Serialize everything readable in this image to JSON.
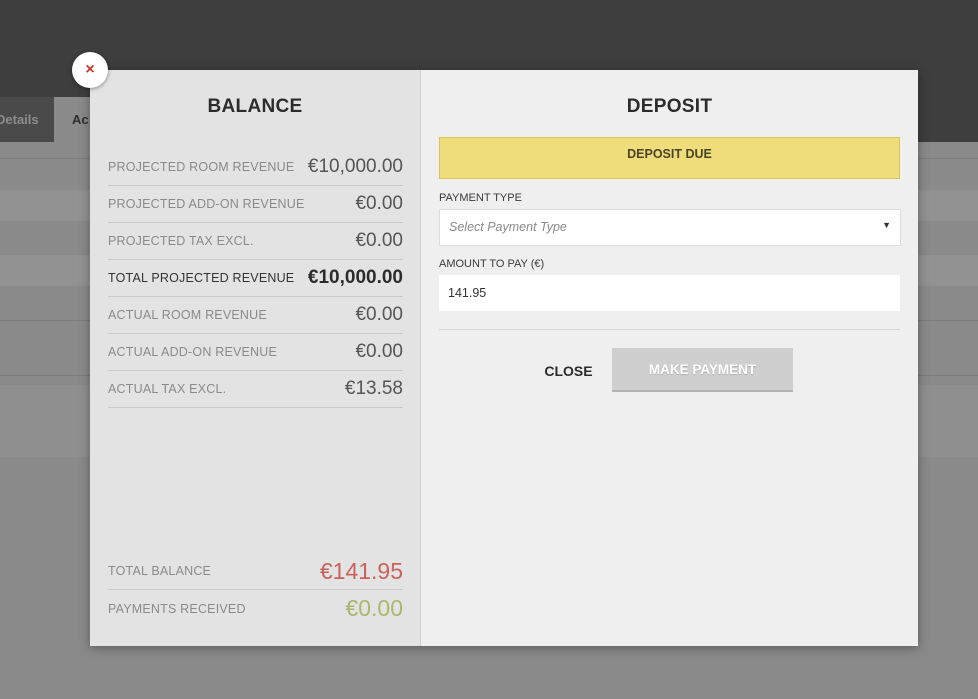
{
  "background": {
    "tab1_label": "Details",
    "tab2_label": "Ac"
  },
  "modal": {
    "close_icon": "×",
    "balance": {
      "title": "BALANCE",
      "rows": [
        {
          "label": "PROJECTED ROOM REVENUE",
          "value": "€10,000.00"
        },
        {
          "label": "PROJECTED ADD-ON REVENUE",
          "value": "€0.00"
        },
        {
          "label": "PROJECTED TAX EXCL.",
          "value": "€0.00"
        },
        {
          "label": "TOTAL PROJECTED REVENUE",
          "value": "€10,000.00"
        },
        {
          "label": "ACTUAL ROOM REVENUE",
          "value": "€0.00"
        },
        {
          "label": "ACTUAL ADD-ON REVENUE",
          "value": "€0.00"
        },
        {
          "label": "ACTUAL TAX EXCL.",
          "value": "€13.58"
        }
      ],
      "total_balance": {
        "label": "TOTAL BALANCE",
        "value": "€141.95"
      },
      "payments_received": {
        "label": "PAYMENTS RECEIVED",
        "value": "€0.00"
      }
    },
    "deposit": {
      "title": "DEPOSIT",
      "banner": "DEPOSIT DUE",
      "payment_type_label": "PAYMENT TYPE",
      "payment_type_placeholder": "Select Payment Type",
      "amount_label": "AMOUNT TO PAY",
      "amount_unit": "(€)",
      "amount_value": "141.95",
      "close_label": "CLOSE",
      "make_payment_label": "MAKE PAYMENT"
    }
  },
  "colors": {
    "banner": "#efdd7c",
    "total_balance": "#c9625a",
    "payments_received": "#a9b86c"
  }
}
